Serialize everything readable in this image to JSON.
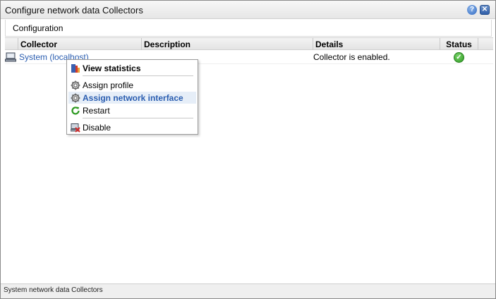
{
  "window": {
    "title": "Configure network data Collectors",
    "help_glyph": "?",
    "close_glyph": "✕"
  },
  "toolbar": {
    "configuration_label": "Configuration"
  },
  "table": {
    "columns": [
      "",
      "Collector",
      "Description",
      "Details",
      "Status",
      ""
    ],
    "rows": [
      {
        "collector": "System (localhost)",
        "description": "",
        "details": "Collector is enabled.",
        "status_icon": "check-circle-icon",
        "status_glyph": "✓"
      }
    ]
  },
  "context_menu": {
    "items": [
      {
        "label": "View statistics",
        "icon": "statistics-icon"
      },
      {
        "label": "Assign profile",
        "icon": "gear-icon"
      },
      {
        "label": "Assign network interface",
        "icon": "gear-icon"
      },
      {
        "label": "Restart",
        "icon": "restart-icon"
      },
      {
        "label": "Disable",
        "icon": "disable-icon"
      }
    ],
    "highlighted_index": 2
  },
  "statusbar": {
    "text": "System network data Collectors"
  },
  "colors": {
    "link": "#2a5db0",
    "highlight_bg": "#e6eef8",
    "status_ok": "#2e9a22"
  }
}
